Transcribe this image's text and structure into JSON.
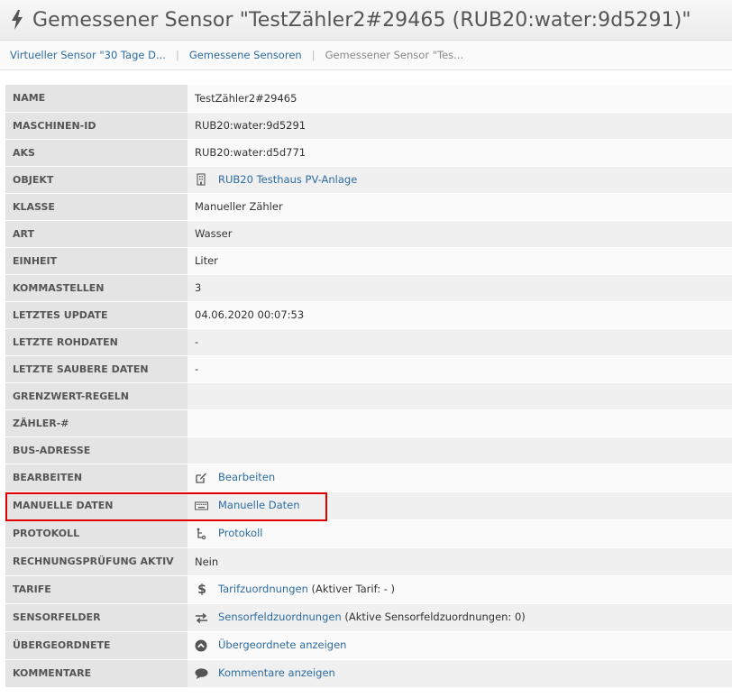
{
  "page": {
    "title": "Gemessener Sensor \"TestZähler2#29465 (RUB20:water:9d5291)\"",
    "title_icon": "bolt-icon"
  },
  "breadcrumb": [
    {
      "label": "Virtueller Sensor \"30 Tage D..."
    },
    {
      "label": "Gemessene Sensoren"
    },
    {
      "label": "Gemessener Sensor \"Tes..."
    }
  ],
  "rows": {
    "name": {
      "label": "NAME",
      "value": "TestZähler2#29465"
    },
    "maschinen_id": {
      "label": "MASCHINEN-ID",
      "value": "RUB20:water:9d5291"
    },
    "aks": {
      "label": "AKS",
      "value": "RUB20:water:d5d771"
    },
    "objekt": {
      "label": "OBJEKT",
      "link": "RUB20 Testhaus PV-Anlage",
      "icon": "building-icon"
    },
    "klasse": {
      "label": "KLASSE",
      "value": "Manueller Zähler"
    },
    "art": {
      "label": "ART",
      "value": "Wasser"
    },
    "einheit": {
      "label": "EINHEIT",
      "value": "Liter"
    },
    "kommastellen": {
      "label": "KOMMASTELLEN",
      "value": "3"
    },
    "letztes_update": {
      "label": "LETZTES UPDATE",
      "value": "04.06.2020 00:07:53"
    },
    "letzte_rohdaten": {
      "label": "LETZTE ROHDATEN",
      "value": "-"
    },
    "letzte_saubere_daten": {
      "label": "LETZTE SAUBERE DATEN",
      "value": "-"
    },
    "grenzwert_regeln": {
      "label": "GRENZWERT-REGELN",
      "value": ""
    },
    "zaehler_nr": {
      "label": "ZÄHLER-#",
      "value": ""
    },
    "bus_adresse": {
      "label": "BUS-ADRESSE",
      "value": ""
    },
    "bearbeiten": {
      "label": "BEARBEITEN",
      "link": "Bearbeiten",
      "icon": "edit-icon"
    },
    "manuelle_daten": {
      "label": "MANUELLE DATEN",
      "link": "Manuelle Daten",
      "icon": "keyboard-icon"
    },
    "protokoll": {
      "label": "PROTOKOLL",
      "link": "Protokoll",
      "icon": "log-icon"
    },
    "rechnungspruefung": {
      "label": "RECHNUNGSPRÜFUNG AKTIV",
      "value": "Nein"
    },
    "tarife": {
      "label": "TARIFE",
      "link": "Tarifzuordnungen",
      "suffix": " (Aktiver Tarif: - )",
      "icon": "dollar-icon"
    },
    "sensorfelder": {
      "label": "SENSORFELDER",
      "link": "Sensorfeldzuordnungen",
      "suffix": " (Aktive Sensorfeldzuordnungen: 0)",
      "icon": "exchange-icon"
    },
    "uebergeordnete": {
      "label": "ÜBERGEORDNETE",
      "link": "Übergeordnete anzeigen",
      "icon": "chevron-up-circle-icon"
    },
    "kommentare": {
      "label": "KOMMENTARE",
      "link": "Kommentare anzeigen",
      "icon": "comment-icon"
    }
  },
  "colors": {
    "link": "#2d6ca2",
    "highlight": "#e00000",
    "key_bg": "#e4e4e4"
  }
}
